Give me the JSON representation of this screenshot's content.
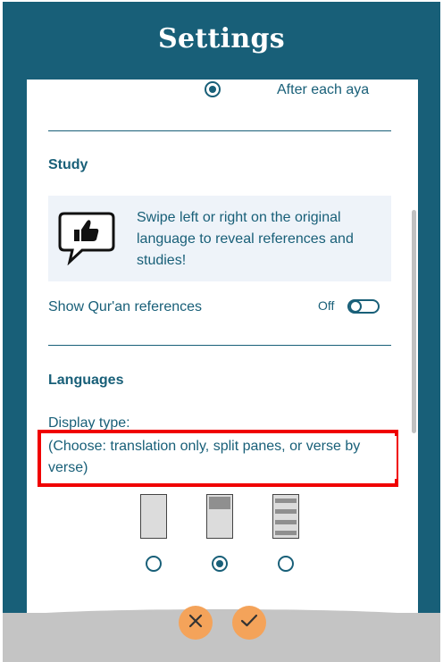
{
  "header": {
    "title": "Settings"
  },
  "display_options": {
    "after_each_aya_label": "After each aya",
    "after_each_aya_selected": true
  },
  "study": {
    "title": "Study",
    "tip_text": "Swipe left or right on the original language to reveal references and studies!",
    "tip_icon": "thumbs-up-speech-bubble-icon",
    "show_references_label": "Show Qur'an references",
    "show_references_state": "Off"
  },
  "languages": {
    "title": "Languages",
    "display_type_label": "Display type:",
    "display_type_help": "(Choose: translation only, split panes, or verse by verse)",
    "layout_options": [
      {
        "icon": "translation-only-layout-icon",
        "selected": false
      },
      {
        "icon": "split-panes-layout-icon",
        "selected": true
      },
      {
        "icon": "verse-by-verse-layout-icon",
        "selected": false
      }
    ]
  },
  "footer": {
    "cancel_icon": "close-icon",
    "confirm_icon": "check-icon"
  },
  "colors": {
    "primary": "#185f78",
    "background": "#ffffff",
    "tip_background": "#eef3f9",
    "footer_button": "#f4a35a",
    "footer_bar": "#c4c4c4",
    "highlight": "#f00000"
  }
}
